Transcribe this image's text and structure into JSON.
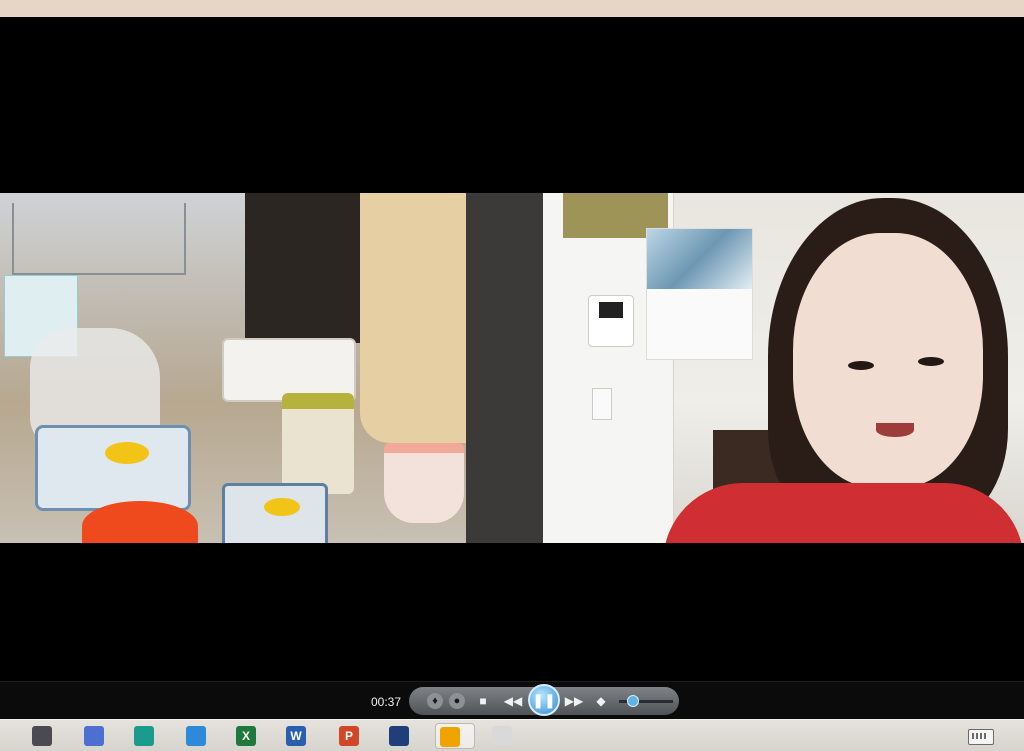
{
  "player": {
    "elapsed_time": "00:37",
    "volume_level": 0.25,
    "state": "playing"
  },
  "controls": {
    "icons": [
      "shield-icon",
      "globe-icon",
      "stop-icon",
      "rewind-icon",
      "pause-icon",
      "fast-forward-icon",
      "volume-icon"
    ]
  },
  "taskbar": {
    "apps": [
      {
        "name": "camera-app",
        "color": "#4a4a52"
      },
      {
        "name": "grid-app",
        "color": "#4c6fd1"
      },
      {
        "name": "publisher-app",
        "color": "#1a9b8e"
      },
      {
        "name": "windows-app",
        "color": "#2c8ad8"
      },
      {
        "name": "excel-app",
        "color": "#1e7a3c",
        "glyph": "X"
      },
      {
        "name": "word-app",
        "color": "#2a5fb0",
        "glyph": "W"
      },
      {
        "name": "powerpoint-app",
        "color": "#d24726",
        "glyph": "P"
      },
      {
        "name": "movie-maker-app",
        "color": "#1f3f7a"
      },
      {
        "name": "media-player-app",
        "color": "#f0a400"
      },
      {
        "name": "paint-app",
        "color": "#d9d9d9"
      }
    ]
  },
  "colors": {
    "accent": "#2e8ad3",
    "background": "#000000",
    "taskbar": "#dcd8d2"
  }
}
